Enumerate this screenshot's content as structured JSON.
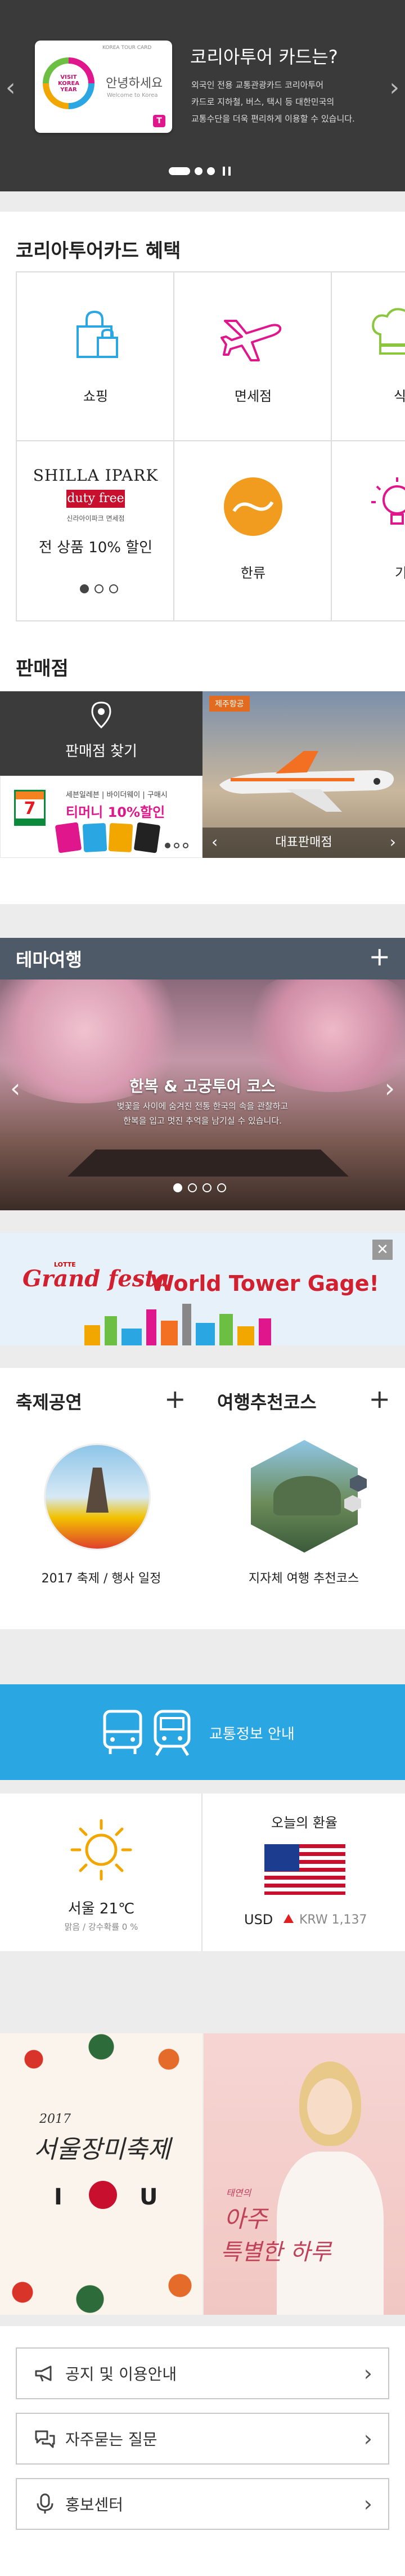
{
  "hero": {
    "card_top_text": "KOREA TOUR CARD",
    "card_logo_text": "VISIT KOREA YEAR",
    "card_greeting": "안녕하세요",
    "card_en": "Welcome to Korea",
    "title": "코리아투어 카드는?",
    "desc1": "외국인 전용 교통관광카드 코리아투어",
    "desc2": "카드로 지하철, 버스, 택시 등 대한민국의",
    "desc3": "교통수단을 더욱 편리하게 이용할 수 있습니다.",
    "pause_icon": "pause-icon"
  },
  "benefits": {
    "title": "코리아투어카드 혜택",
    "items": [
      {
        "label": "쇼핑",
        "icon": "shopping-bag-icon"
      },
      {
        "label": "면세점",
        "icon": "airplane-icon"
      },
      {
        "label": "식",
        "icon": "chef-hat-icon"
      },
      {
        "label": "한류",
        "icon": "taeguk-icon"
      },
      {
        "label": "기",
        "icon": "lightbulb-icon"
      }
    ],
    "promo": {
      "brand1": "SHILLA IPARK",
      "brand2": "duty free",
      "brand_sub": "신라아이파크 면세점",
      "offer": "전 상품 10% 할인"
    }
  },
  "stores": {
    "title": "판매점",
    "find_label": "판매점 찾기",
    "promo_brand": "세븐일레븐 | 바이더웨이 | 구매시",
    "promo_text": "티머니 10%할인",
    "airline_badge": "제주항공",
    "rep_label": "대표판매점"
  },
  "theme": {
    "title": "테마여행",
    "course_title": "한복 & 고궁투어 코스",
    "course_desc1": "벚꽃을 사이에 숨겨진 전통 한국의 속을 관찰하고",
    "course_desc2": "한복을 입고 멋진 추억을 남기실 수 있습니다."
  },
  "banner": {
    "brand_small": "LOTTE",
    "brand": "Grand festa",
    "text": "World Tower Gage!"
  },
  "festival": {
    "title": "축제공연",
    "caption": "2017 축제 / 행사 일정"
  },
  "course": {
    "title": "여행추천코스",
    "caption": "지자체 여행 추천코스"
  },
  "transport": {
    "label": "교통정보 안내"
  },
  "weather": {
    "city_temp": "서울  21℃",
    "detail": "맑음 / 강수확률 0 %"
  },
  "exchange": {
    "title": "오늘의 환율",
    "currency": "USD",
    "value": "KRW 1,137"
  },
  "posters": {
    "left_year": "2017",
    "left_title": "서울장미축제",
    "left_i": "I",
    "left_u": "U",
    "right_title1": "아주",
    "right_title2": "특별한 하루",
    "right_small": "태연의"
  },
  "links": [
    {
      "label": "공지 및 이용안내",
      "icon": "megaphone-icon"
    },
    {
      "label": "자주묻는 질문",
      "icon": "chat-bubbles-icon"
    },
    {
      "label": "홍보센터",
      "icon": "microphone-icon"
    }
  ],
  "colors": {
    "accent_blue": "#2aa7e2",
    "magenta": "#e0168c",
    "dark_gray": "#3b3b3b",
    "slate": "#4f5a68"
  }
}
